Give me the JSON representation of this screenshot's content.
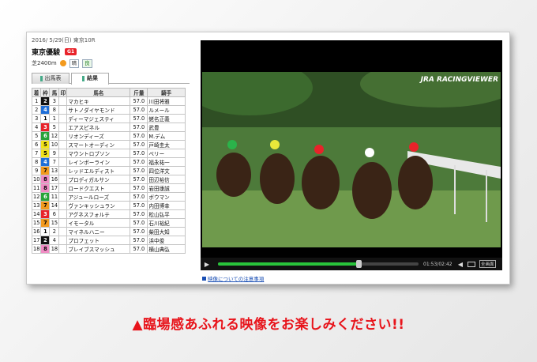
{
  "race": {
    "date_line": "2016/ 5/29(日) 東京10R",
    "name": "東京優駿",
    "grade": "G1",
    "distance": "芝2400m",
    "weather": "晴",
    "going": "良"
  },
  "tabs": [
    {
      "label": "出馬表",
      "active": false
    },
    {
      "label": "結果",
      "active": true
    }
  ],
  "table": {
    "headers": [
      "着",
      "枠",
      "馬",
      "印",
      "馬名",
      "斤量",
      "騎手"
    ],
    "rows": [
      {
        "rank": "1",
        "frame": "2",
        "horse": "3",
        "mark": "",
        "name": "マカヒキ",
        "weight": "57.0",
        "jockey": "川田将雅"
      },
      {
        "rank": "2",
        "frame": "4",
        "horse": "8",
        "mark": "",
        "name": "サトノダイヤモンド",
        "weight": "57.0",
        "jockey": "ルメール"
      },
      {
        "rank": "3",
        "frame": "1",
        "horse": "1",
        "mark": "",
        "name": "ディーマジェスティ",
        "weight": "57.0",
        "jockey": "蛯名正義"
      },
      {
        "rank": "4",
        "frame": "3",
        "horse": "5",
        "mark": "",
        "name": "エアスピネル",
        "weight": "57.0",
        "jockey": "武豊"
      },
      {
        "rank": "5",
        "frame": "6",
        "horse": "12",
        "mark": "",
        "name": "リオンディーズ",
        "weight": "57.0",
        "jockey": "M.デム"
      },
      {
        "rank": "6",
        "frame": "5",
        "horse": "10",
        "mark": "",
        "name": "スマートオーディン",
        "weight": "57.0",
        "jockey": "戸崎圭太"
      },
      {
        "rank": "7",
        "frame": "5",
        "horse": "9",
        "mark": "",
        "name": "マウントロブソン",
        "weight": "57.0",
        "jockey": "ベリー"
      },
      {
        "rank": "8",
        "frame": "4",
        "horse": "7",
        "mark": "",
        "name": "レインボーライン",
        "weight": "57.0",
        "jockey": "福永祐一"
      },
      {
        "rank": "9",
        "frame": "7",
        "horse": "13",
        "mark": "",
        "name": "レッドエルディスト",
        "weight": "57.0",
        "jockey": "四位洋文"
      },
      {
        "rank": "10",
        "frame": "8",
        "horse": "16",
        "mark": "",
        "name": "プロディガルサン",
        "weight": "57.0",
        "jockey": "田辺裕信"
      },
      {
        "rank": "11",
        "frame": "8",
        "horse": "17",
        "mark": "",
        "name": "ロードクエスト",
        "weight": "57.0",
        "jockey": "岩田康誠"
      },
      {
        "rank": "12",
        "frame": "6",
        "horse": "11",
        "mark": "",
        "name": "アジュールローズ",
        "weight": "57.0",
        "jockey": "ボウマン"
      },
      {
        "rank": "13",
        "frame": "7",
        "horse": "14",
        "mark": "",
        "name": "ヴァンキッシュラン",
        "weight": "57.0",
        "jockey": "内田博幸"
      },
      {
        "rank": "14",
        "frame": "3",
        "horse": "6",
        "mark": "",
        "name": "アグネスフォルテ",
        "weight": "57.0",
        "jockey": "松山弘平"
      },
      {
        "rank": "15",
        "frame": "7",
        "horse": "15",
        "mark": "",
        "name": "イモータル",
        "weight": "57.0",
        "jockey": "石川裕紀"
      },
      {
        "rank": "16",
        "frame": "1",
        "horse": "2",
        "mark": "",
        "name": "マイネルハニー",
        "weight": "57.0",
        "jockey": "柴田大知"
      },
      {
        "rank": "17",
        "frame": "2",
        "horse": "4",
        "mark": "",
        "name": "プロフェット",
        "weight": "57.0",
        "jockey": "浜中俊"
      },
      {
        "rank": "18",
        "frame": "8",
        "horse": "18",
        "mark": "",
        "name": "ブレイブスマッシュ",
        "weight": "57.0",
        "jockey": "横山典弘"
      }
    ]
  },
  "frame_colors": {
    "1": {
      "bg": "#ffffff",
      "fg": "#000000"
    },
    "2": {
      "bg": "#111111",
      "fg": "#ffffff"
    },
    "3": {
      "bg": "#e8232a",
      "fg": "#ffffff"
    },
    "4": {
      "bg": "#1f6fd8",
      "fg": "#ffffff"
    },
    "5": {
      "bg": "#f2e21a",
      "fg": "#000000"
    },
    "6": {
      "bg": "#28a33a",
      "fg": "#ffffff"
    },
    "7": {
      "bg": "#f39a1e",
      "fg": "#000000"
    },
    "8": {
      "bg": "#f08cc4",
      "fg": "#000000"
    }
  },
  "player": {
    "watermark": "JRA RACINGVIEWER",
    "time": "01:53/02:42",
    "progress": 0.7,
    "fullscreen_label": "全画面"
  },
  "notice": "映像についての注意事項",
  "banner": "▲臨場感あふれる映像をお楽しみください!!"
}
